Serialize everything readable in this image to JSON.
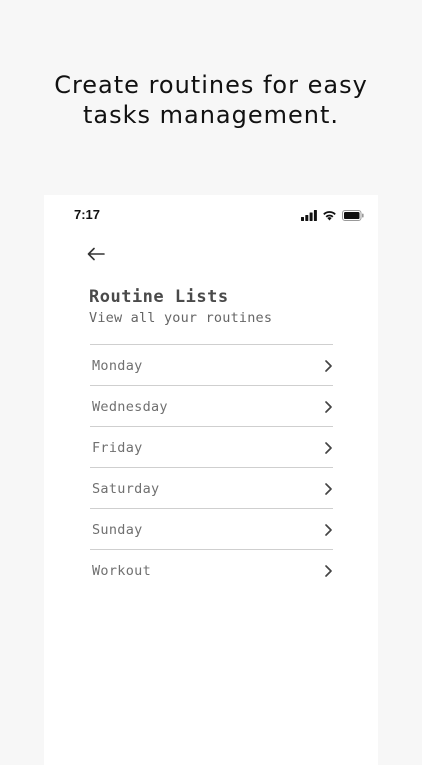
{
  "headline": {
    "line1": "Create routines for easy",
    "line2": "tasks management."
  },
  "status_bar": {
    "time": "7:17",
    "icons": [
      "signal-icon",
      "wifi-icon",
      "battery-icon"
    ]
  },
  "nav": {
    "back_icon": "arrow-left-icon"
  },
  "screen": {
    "title": "Routine Lists",
    "subtitle": "View all your routines"
  },
  "routines": [
    {
      "label": "Monday",
      "icon": "chevron-right-icon"
    },
    {
      "label": "Wednesday",
      "icon": "chevron-right-icon"
    },
    {
      "label": "Friday",
      "icon": "chevron-right-icon"
    },
    {
      "label": "Saturday",
      "icon": "chevron-right-icon"
    },
    {
      "label": "Sunday",
      "icon": "chevron-right-icon"
    },
    {
      "label": "Workout",
      "icon": "chevron-right-icon"
    }
  ],
  "colors": {
    "background": "#f7f7f7",
    "card": "#ffffff",
    "text_dark": "#111111",
    "text_muted": "#707070",
    "divider": "#cfcfcf"
  }
}
